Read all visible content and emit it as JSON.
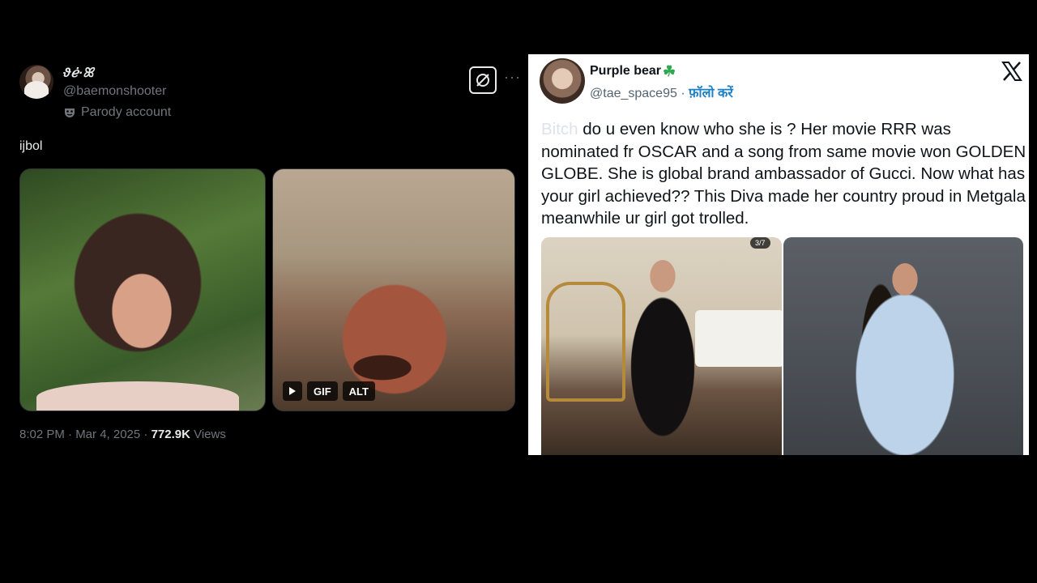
{
  "left_tweet": {
    "name": "ϑℯ̇·ꕤ",
    "handle": "@baemonshooter",
    "parody_label": "Parody account",
    "more_label": "···",
    "text": "ijbol",
    "gif_label": "GIF",
    "alt_label": "ALT",
    "timestamp": "8:02 PM · Mar 4, 2025 · ",
    "views_count": "772.9K",
    "views_label": " Views"
  },
  "right_tweet": {
    "name": "Purple bear",
    "clover": "☘",
    "handle": "@tae_space95",
    "separator": " · ",
    "follow_label": "फ़ॉलो करें",
    "blurred_word": "Bitch",
    "text": " do u even know who she is ? Her movie RRR was nominated fr OSCAR and a song from same movie won GOLDEN GLOBE. She is global brand ambassador of Gucci. Now what has your girl achieved?? This Diva made her country proud in Metgala  meanwhile ur girl got trolled.",
    "photo_counter": "3/7"
  }
}
